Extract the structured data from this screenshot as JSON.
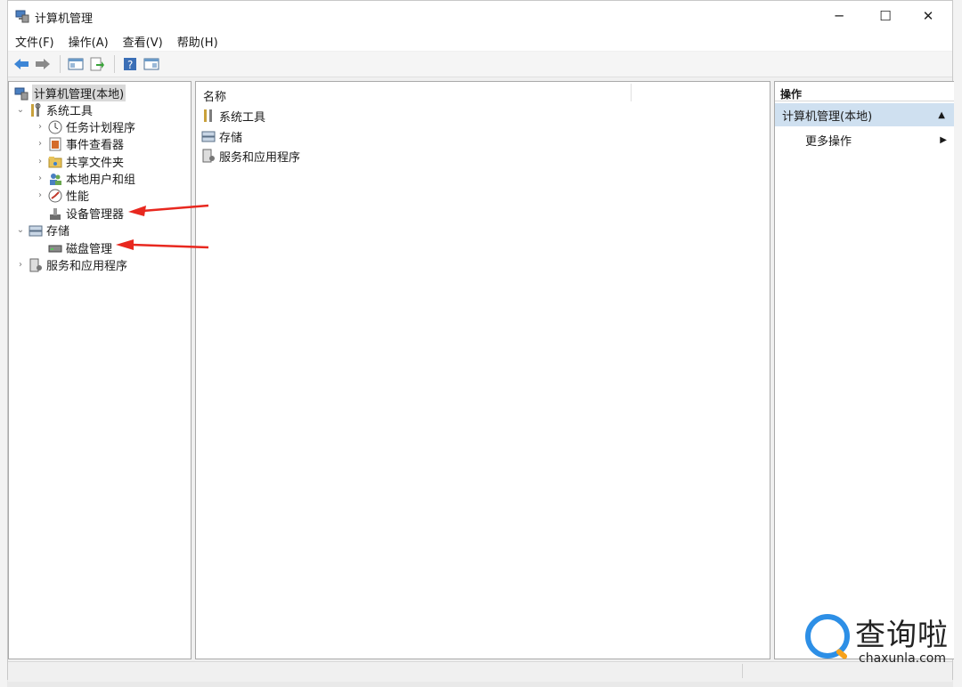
{
  "window": {
    "title": "计算机管理",
    "controls": [
      "─",
      "☐",
      "✕"
    ]
  },
  "menu": [
    "文件(F)",
    "操作(A)",
    "查看(V)",
    "帮助(H)"
  ],
  "tree": {
    "root": "计算机管理(本地)",
    "system_tools": "系统工具",
    "task_scheduler": "任务计划程序",
    "event_viewer": "事件查看器",
    "shared_folders": "共享文件夹",
    "local_users": "本地用户和组",
    "performance": "性能",
    "device_manager": "设备管理器",
    "storage": "存储",
    "disk_management": "磁盘管理",
    "services": "服务和应用程序"
  },
  "content": {
    "column_name": "名称",
    "items": [
      "系统工具",
      "存储",
      "服务和应用程序"
    ]
  },
  "actions": {
    "header": "操作",
    "selected": "计算机管理(本地)",
    "more": "更多操作"
  },
  "watermark": {
    "title": "查询啦",
    "site": "chaxunla.com"
  },
  "colors": {
    "selection": "#cfe0f0",
    "arrow": "#e8281f",
    "watermark_blue": "#2d8fe6"
  }
}
